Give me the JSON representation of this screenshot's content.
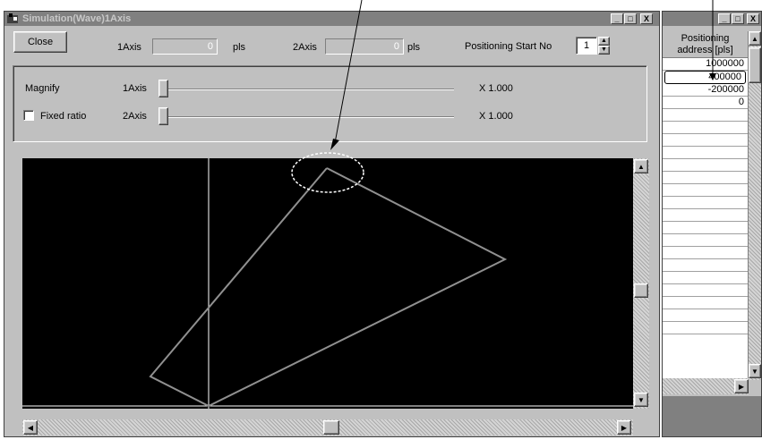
{
  "window": {
    "title": "Simulation(Wave)1Axis",
    "controls": [
      "_",
      "□",
      "X"
    ]
  },
  "toolbar": {
    "close_label": "Close",
    "axis1_label": "1Axis",
    "axis1_value": "0",
    "axis1_unit": "pls",
    "axis2_label": "2Axis",
    "axis2_value": "0",
    "axis2_unit": "pls",
    "start_no_label": "Positioning Start No",
    "start_no_value": "1"
  },
  "magnify": {
    "label": "Magnify",
    "axis1_label": "1Axis",
    "axis1_scale": "X 1.000",
    "axis1_slider_level": 0,
    "fixed_ratio_label": "Fixed ratio",
    "fixed_ratio_checked": false,
    "axis2_label": "2Axis",
    "axis2_scale": "X 1.000",
    "axis2_slider_level": 0
  },
  "side_window": {
    "controls": [
      "_",
      "□",
      "X"
    ],
    "header_line1": "Positioning",
    "header_line2": "address [pls]",
    "rows": [
      "1000000",
      "400000",
      "-200000",
      "0",
      "",
      "",
      "",
      "",
      "",
      "",
      "",
      "",
      "",
      "",
      "",
      "",
      "",
      "",
      "",
      "",
      "",
      ""
    ]
  },
  "colors": {
    "title_bar": "#808080",
    "face": "#c0c0c0",
    "plot_bg": "#000000",
    "trace": "#909090",
    "axis_line": "#ffffff"
  }
}
